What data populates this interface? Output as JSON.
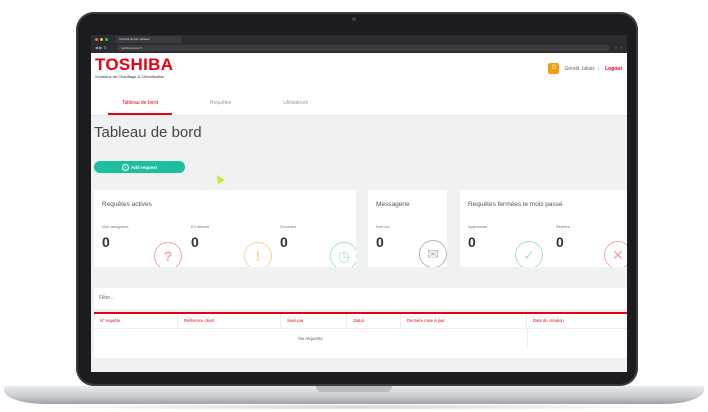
{
  "browser": {
    "tab_title": "Toshiba Suivis: tableau",
    "url": "toshiba-demo.fr",
    "traffic_colors": [
      "#ff5f57",
      "#febc2e",
      "#28c840"
    ]
  },
  "header": {
    "logo": "TOSHIBA",
    "tagline": "Solutions de Chauffage & Climatisation",
    "user_initial": "G",
    "user_name": "Gérald Jallais",
    "separator": "|",
    "logout": "Logout"
  },
  "tabs": [
    {
      "label": "Tableau de bord",
      "active": true
    },
    {
      "label": "Requêtes",
      "active": false
    },
    {
      "label": "Utilisateurs",
      "active": false
    }
  ],
  "page": {
    "title": "Tableau de bord",
    "add_button": "Add request"
  },
  "cards": {
    "active": {
      "title": "Requêtes actives",
      "metrics": [
        {
          "label": "Non assignées",
          "value": "0",
          "icon": "question-icon",
          "color": "#f5a6a6",
          "glyph": "?"
        },
        {
          "label": "En attente",
          "value": "0",
          "icon": "alert-icon",
          "color": "#f8d5a3",
          "glyph": "!"
        },
        {
          "label": "Ouvertes",
          "value": "0",
          "icon": "clock-icon",
          "color": "#a9dfc9",
          "glyph": "◷"
        }
      ]
    },
    "messages": {
      "title": "Messagerie",
      "metrics": [
        {
          "label": "Non lus",
          "value": "0",
          "icon": "envelope-icon",
          "color": "#b5b5b5",
          "glyph": "✉"
        }
      ]
    },
    "closed": {
      "title": "Requêtes fermées le mois passé",
      "metrics": [
        {
          "label": "Approuvés",
          "value": "0",
          "icon": "check-icon",
          "color": "#a9dfc9",
          "glyph": "✓"
        },
        {
          "label": "Rejetés",
          "value": "0",
          "icon": "x-icon",
          "color": "#f5a6a6",
          "glyph": "✕"
        }
      ]
    }
  },
  "table": {
    "filter_placeholder": "Filter...",
    "columns": [
      "N° requête",
      "Référence client",
      "Suivi par",
      "Statut",
      "Dernière mise à jour",
      "Date de création"
    ],
    "empty_text": "No requests"
  }
}
